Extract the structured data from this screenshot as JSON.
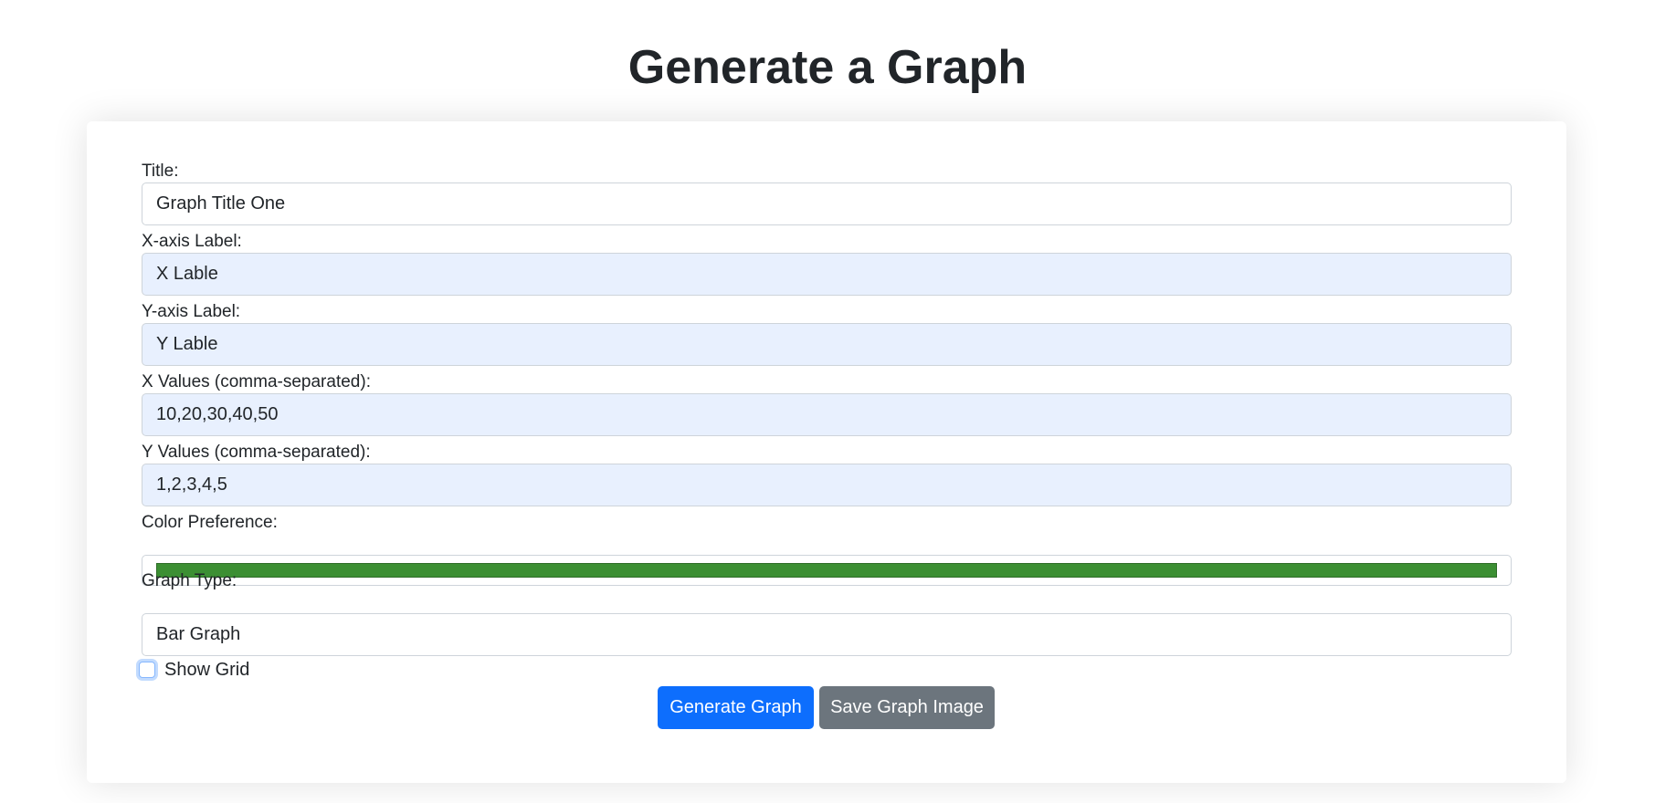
{
  "page": {
    "title": "Generate a Graph"
  },
  "form": {
    "title_label": "Title:",
    "title_value": "Graph Title One",
    "xlabel_label": "X-axis Label:",
    "xlabel_value": "X Lable",
    "ylabel_label": "Y-axis Label:",
    "ylabel_value": "Y Lable",
    "xvalues_label": "X Values (comma-separated):",
    "xvalues_value": "10,20,30,40,50",
    "yvalues_label": "Y Values (comma-separated):",
    "yvalues_value": "1,2,3,4,5",
    "color_label": "Color Preference:",
    "color_value": "#3c8f33",
    "graph_type_label": "Graph Type:",
    "graph_type_value": "Bar Graph",
    "show_grid_label": "Show Grid",
    "show_grid_checked": false
  },
  "buttons": {
    "generate_label": "Generate Graph",
    "save_label": "Save Graph Image"
  },
  "colors": {
    "primary": "#0d6efd",
    "secondary": "#6c757d",
    "autofill_bg": "#e8f0fe"
  }
}
